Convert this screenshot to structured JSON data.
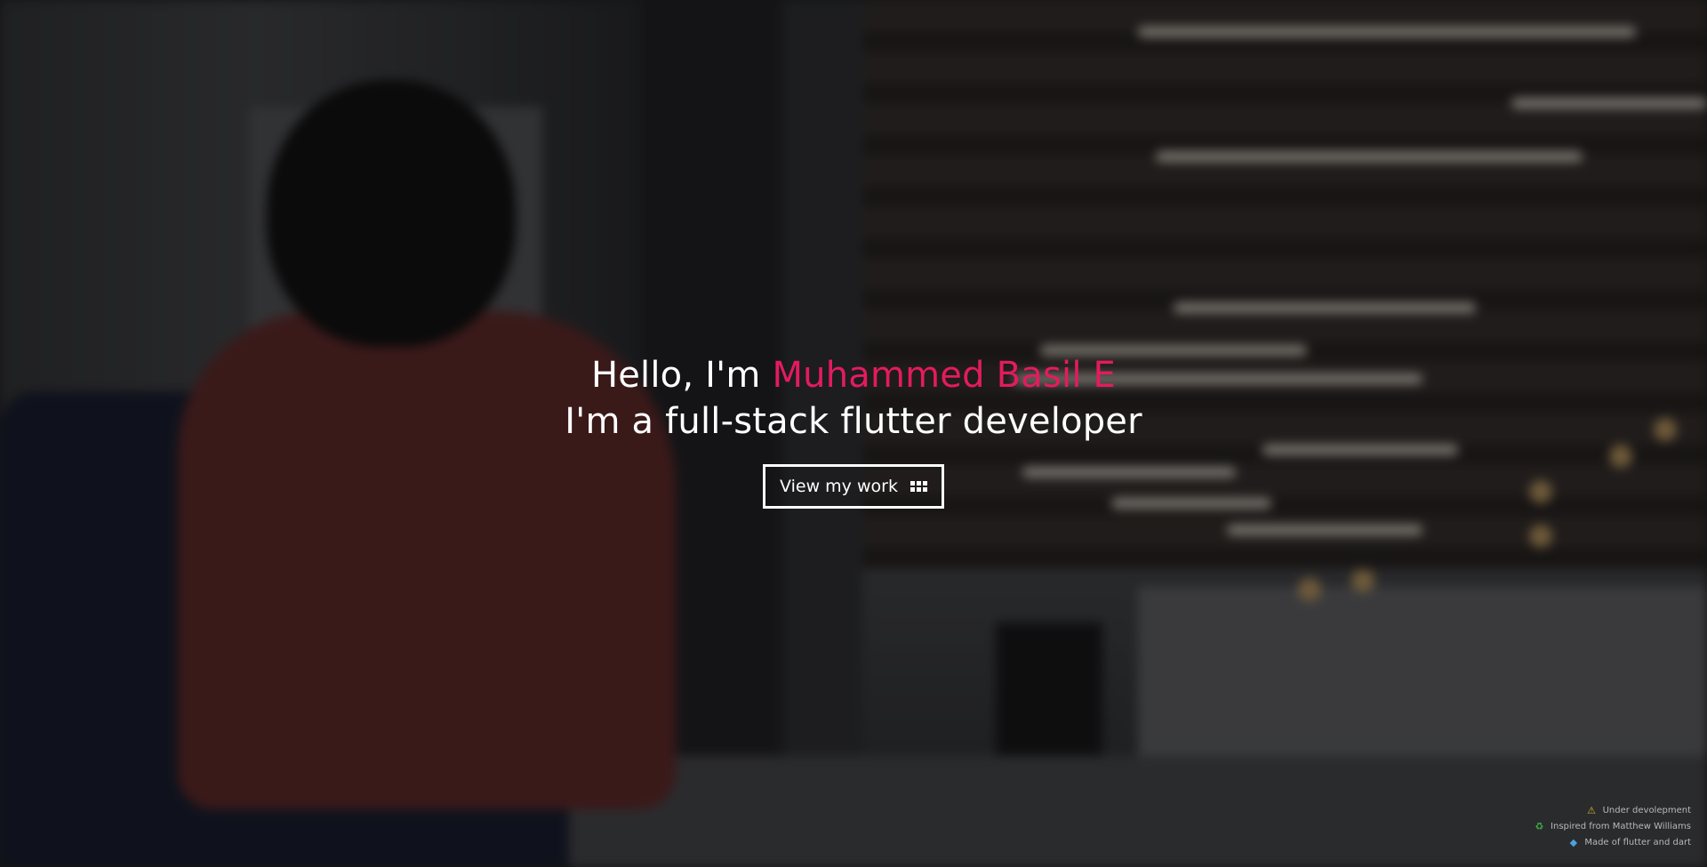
{
  "hero": {
    "greeting": "Hello, I'm ",
    "name": "Muhammed Basil E",
    "tagline": "I'm a full-stack flutter developer",
    "cta_label": "View my work",
    "cta_icon": "grid-icon",
    "name_color": "#e31b5f"
  },
  "footer": {
    "items": [
      {
        "icon": "warning-icon",
        "label": "Under devolepment"
      },
      {
        "icon": "recycle-icon",
        "label": "Inspired from Matthew Williams"
      },
      {
        "icon": "flutter-icon",
        "label": "Made of flutter and dart"
      }
    ]
  }
}
